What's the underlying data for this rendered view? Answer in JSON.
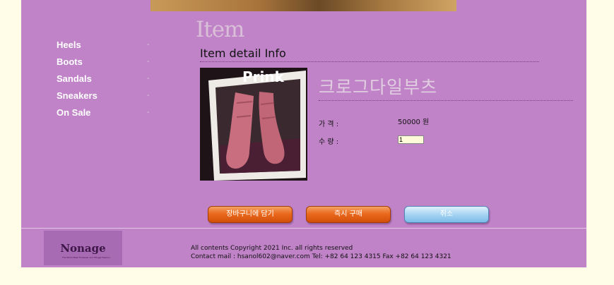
{
  "section_title": "Item",
  "sidebar": {
    "items": [
      {
        "label": "Heels",
        "dash": "-"
      },
      {
        "label": "Boots",
        "dash": "-"
      },
      {
        "label": "Sandals",
        "dash": "-"
      },
      {
        "label": "Sneakers",
        "dash": "-"
      },
      {
        "label": "On Sale",
        "dash": "-"
      }
    ]
  },
  "detail": {
    "heading": "Item detail Info",
    "photo_caption": "Prink",
    "product_name": "크로그다일부츠",
    "price_label": "가 격 :",
    "price_value": "50000 원",
    "qty_label": "수 량 :",
    "qty_value": "1"
  },
  "buttons": {
    "cart": "장바구니에 담기",
    "buy_now": "즉시 구매",
    "cancel": "취소"
  },
  "footer": {
    "logo_text": "Nonage",
    "logo_sub": "The World Best Footwear and Mirage Fashion",
    "copyright": "All contents Copyright 2021 Inc. all rights reserved",
    "contact": "Contact mail : hsanol602@naver.com Tel: +82 64 123 4315 Fax +82 64 123 4321"
  },
  "colors": {
    "page_bg": "#fffde8",
    "content_bg": "#c083c8",
    "orange_button": "#ea6a1e",
    "blue_button": "#a6d4f2"
  }
}
